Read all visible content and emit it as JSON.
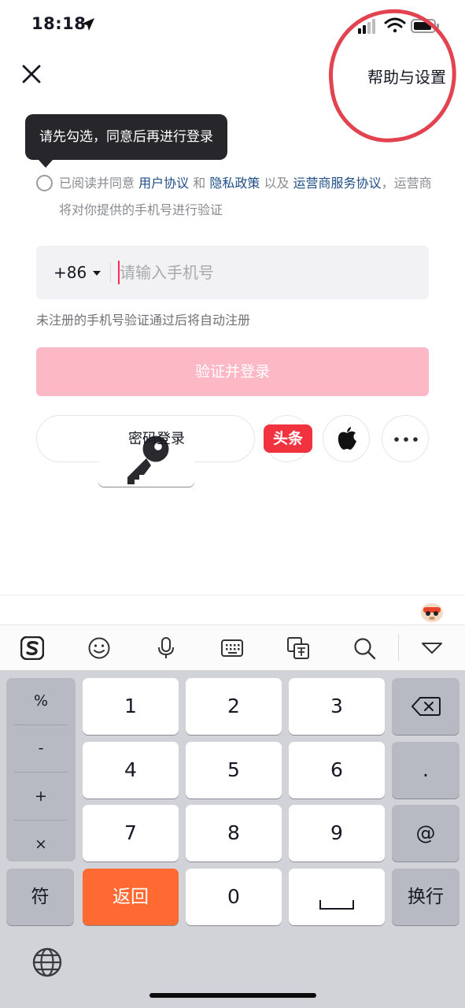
{
  "status_bar": {
    "time": "18:18"
  },
  "header": {
    "help_label": "帮助与设置"
  },
  "tooltip": {
    "text": "请先勾选，同意后再进行登录"
  },
  "agreement": {
    "prefix": "已阅读并同意",
    "user_agreement": "用户协议",
    "and": "和",
    "privacy_policy": "隐私政策",
    "also": "以及",
    "operator_agreement": "运营商服务协议",
    "suffix": "，运营商将对你提供的手机号进行验证"
  },
  "phone_input": {
    "country_code": "+86",
    "placeholder": "请输入手机号",
    "value": ""
  },
  "hint": "未注册的手机号验证通过后将自动注册",
  "login_button": "验证并登录",
  "alt_login": {
    "password_label": "密码登录",
    "toutiao_label": "头条"
  },
  "keyboard": {
    "side_keys": [
      "%",
      "-",
      "+",
      "×"
    ],
    "digits": [
      "1",
      "2",
      "3",
      "4",
      "5",
      "6",
      "7",
      "8",
      "9",
      "0"
    ],
    "symbol_key": "符",
    "back_key": "返回",
    "enter_key": "换行",
    "dot_key": ".",
    "at_key": "@"
  },
  "colors": {
    "accent": "#fe2c55",
    "login_disabled": "#fdb8c6",
    "link": "#1e4e86",
    "annotation": "#e2434f",
    "back_key": "#ff6a33"
  }
}
